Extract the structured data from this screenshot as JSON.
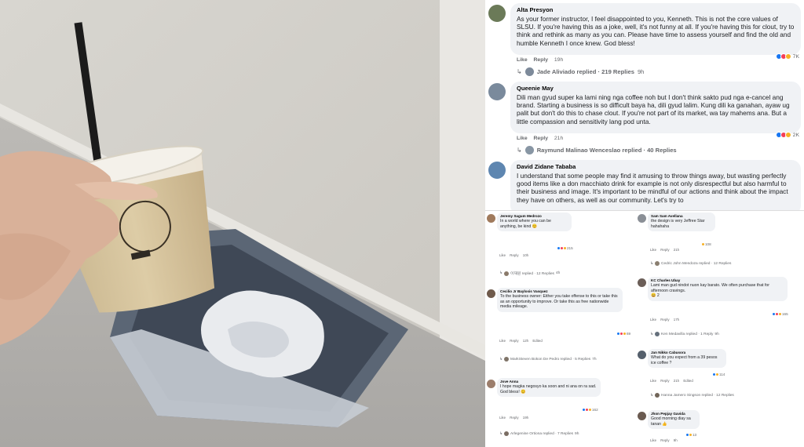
{
  "colors": {
    "like": "#1877f2",
    "love": "#f33e58",
    "haha": "#f7b125",
    "bubble": "#f0f2f5"
  },
  "top_comments": [
    {
      "name": "Alta Presyon",
      "text": "As your former instructor, I feel disappointed to you, Kenneth. This is not the core values of SLSU. If you're having this as a joke, well, it's not funny at all. If you're having this for clout, try to think and rethink as many as you can. Please have time to assess yourself and find the old and humble Kenneth I once knew. God bless!",
      "like": "Like",
      "reply": "Reply",
      "time": "19h",
      "reactions": "7K",
      "replies": "Jade Aliviado replied · 219 Replies",
      "replies_time": "9h"
    },
    {
      "name": "Queenie May",
      "text": "Dili man gyud super ka lami ning nga coffee noh but I don't think sakto pud nga e-cancel ang brand. Starting a business is so difficult baya ha, dili gyud lalim. Kung dili ka ganahan, ayaw ug palit but don't do this to chase clout. If you're not part of its market, wa tay mahems ana. But a little compassion and sensitivity lang pod unta.",
      "like": "Like",
      "reply": "Reply",
      "time": "21h",
      "reactions": "2K",
      "replies": "Raymund Malinao Wenceslao replied · 40 Replies",
      "replies_time": ""
    },
    {
      "name": "David Zidane Tababa",
      "text": "I understand that some people may find it amusing to throw things away, but wasting perfectly good items like a don macchiato drink for example is not only disrespectful but also harmful to their business and image. It's important to be mindful of our actions and think about the impact they have on others, as well as our community. Let's try to"
    }
  ],
  "small_comments_left": [
    {
      "name": "Jeremy Sagum Medrozo",
      "text": "In a world where you can be anything, be kind 😊",
      "like": "Like",
      "reply": "Reply",
      "time": "10h",
      "reactions": "215",
      "replies": "이재원 replied · 12 Replies",
      "replies_time": "4h"
    },
    {
      "name": "Cecilio Jr Baylosis Vasquez",
      "text": "To the business owner: Either you take offense to this or take this as an opportunity to improve. Or take this as free nationwide media mileage.",
      "like": "Like",
      "reply": "Reply",
      "time": "12h",
      "edited": "Edited",
      "reactions": "69",
      "replies": "MarkSteven Bokon De Pedro replied · 5 Replies",
      "replies_time": "7h"
    },
    {
      "name": "Jove Anna",
      "text": "I hope magka negosyo ka soon and ni ana on ra sad. God bless! 😊",
      "like": "Like",
      "reply": "Reply",
      "time": "19h",
      "reactions": "162",
      "replies": "Arlegenine Ortiona replied · 7 Replies",
      "replies_time": "9h"
    }
  ],
  "small_comments_right": [
    {
      "name": "Sam Sam Avellana",
      "text": "the design is very Jeffree Star hahahaha",
      "like": "Like",
      "reply": "Reply",
      "time": "21h",
      "reactions": "108",
      "replies": "Cedric John Mendoza replied · 12 Replies",
      "replies_time": ""
    },
    {
      "name": "KC Charles Ubay",
      "text": "Lami man gud nindot nuon kay barato. We often purchase that for afternoon cravings.",
      "like": "Like",
      "reply": "Reply",
      "time": "17h",
      "reactions": "165",
      "extra": "2",
      "replies": "Ken Medavilla replied · 1 Reply",
      "replies_time": "9h"
    },
    {
      "name": "Jan Nikko Cabusora",
      "text": "What do you expect from a 39 pesos ice coffee ?",
      "like": "Like",
      "reply": "Reply",
      "time": "21h",
      "edited": "Edited",
      "reactions": "114",
      "replies": "Hanna Jamero Singson replied · 12 Replies",
      "replies_time": ""
    },
    {
      "name": "Jhon Pepjay Gavida",
      "text": "Good morning diay sa tanan 👍",
      "like": "Like",
      "reply": "Reply",
      "time": "9h",
      "reactions": "13"
    }
  ]
}
